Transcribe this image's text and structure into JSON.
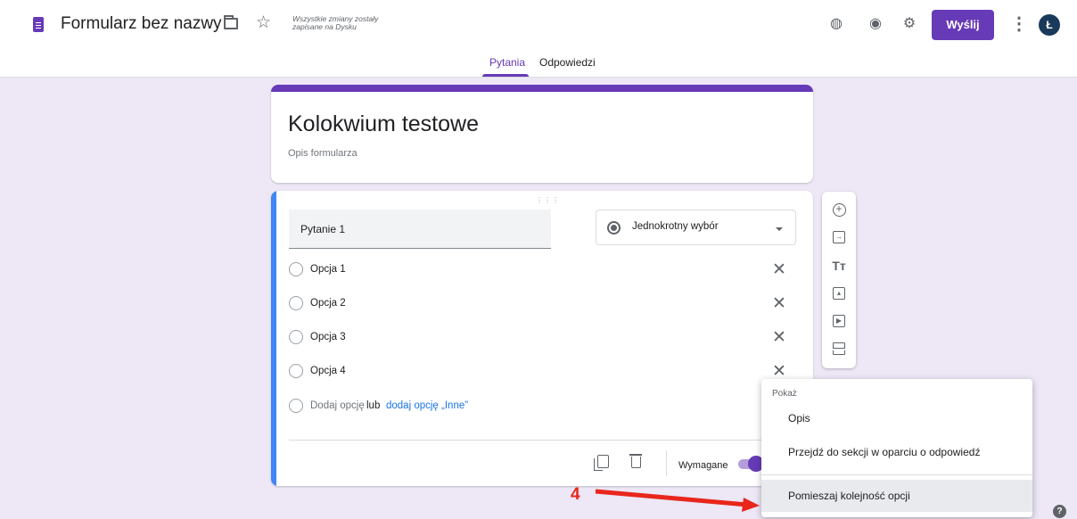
{
  "header": {
    "app_title": "Formularz bez nazwy",
    "save_status": "Wszystkie zmiany zostały zapisane na Dysku",
    "send_label": "Wyślij",
    "avatar_letter": "Ł",
    "icons": [
      "forms-logo-icon",
      "folder-icon",
      "star-icon",
      "palette-icon",
      "eye-icon",
      "gear-icon",
      "more-vert-icon"
    ]
  },
  "tabs": {
    "questions": "Pytania",
    "answers": "Odpowiedzi",
    "active": "Pytania"
  },
  "form": {
    "title": "Kolokwium testowe",
    "description_placeholder": "Opis formularza"
  },
  "question": {
    "title": "Pytanie 1",
    "type": "Jednokrotny wybór",
    "options": [
      "Opcja 1",
      "Opcja 2",
      "Opcja 3",
      "Opcja 4"
    ],
    "add_option": "Dodaj opcję",
    "or": "lub",
    "add_other": "dodaj opcję „Inne”",
    "required_label": "Wymagane",
    "required_on": true
  },
  "context_menu": {
    "header": "Pokaż",
    "items": [
      "Opis",
      "Przejdź do sekcji w oparciu o odpowiedź",
      "Pomieszaj kolejność opcji"
    ],
    "highlighted": "Pomieszaj kolejność opcji"
  },
  "annotation": {
    "number": "4",
    "color": "#e8261c"
  },
  "colors": {
    "accent": "#673ab7",
    "background": "#ede7f6",
    "active_question_bar": "#4285f4",
    "link": "#1a73e8"
  }
}
